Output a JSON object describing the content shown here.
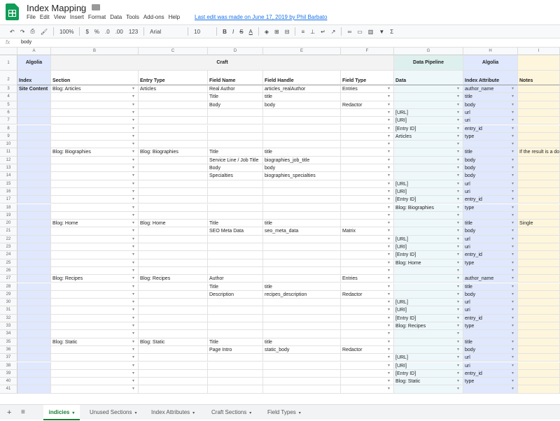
{
  "app": {
    "title": "Index Mapping",
    "last_edit": "Last edit was made on June 17, 2019 by Phil Barbato"
  },
  "menu": [
    "File",
    "Edit",
    "View",
    "Insert",
    "Format",
    "Data",
    "Tools",
    "Add-ons",
    "Help"
  ],
  "toolbar": {
    "zoom": "100%",
    "currency": "$",
    "percent": "%",
    ".0": ".0",
    ".00": ".00",
    "format_more": "123",
    "font": "Arial",
    "font_size": "10",
    "bold": "B",
    "italic": "I",
    "strike": "S",
    "text_color": "A"
  },
  "formula_bar": {
    "fx": "fx",
    "value": "body"
  },
  "columns": [
    "A",
    "B",
    "C",
    "D",
    "E",
    "F",
    "G",
    "H",
    "I"
  ],
  "header_rows": {
    "row1": {
      "index": "1",
      "algolia": "Algolia",
      "craft": "Craft",
      "pipeline": "Data Pipeline",
      "algolia2": "Algolia"
    },
    "row2": {
      "index": "2",
      "cols": [
        "Index",
        "Section",
        "Entry Type",
        "Field Name",
        "Field Handle",
        "Field Type",
        "Data",
        "Index Attribute",
        "Notes"
      ]
    }
  },
  "rows": [
    {
      "n": "3",
      "a": "Site Content",
      "b": "Blog: Articles",
      "c": "Articles",
      "d": "Real Author",
      "e": "articles_realAuthor",
      "f": "Entries",
      "g": "",
      "h": "author_name",
      "i": ""
    },
    {
      "n": "4",
      "a": "",
      "b": "",
      "c": "",
      "d": "Title",
      "e": "title",
      "f": "",
      "g": "",
      "h": "title",
      "i": ""
    },
    {
      "n": "5",
      "a": "",
      "b": "",
      "c": "",
      "d": "Body",
      "e": "body",
      "f": "Redactor",
      "g": "",
      "h": "body",
      "i": ""
    },
    {
      "n": "6",
      "a": "",
      "b": "",
      "c": "",
      "d": "",
      "e": "",
      "f": "",
      "g": "[URL]",
      "h": "url",
      "i": ""
    },
    {
      "n": "7",
      "a": "",
      "b": "",
      "c": "",
      "d": "",
      "e": "",
      "f": "",
      "g": "[URI]",
      "h": "uri",
      "i": ""
    },
    {
      "n": "8",
      "a": "",
      "b": "",
      "c": "",
      "d": "",
      "e": "",
      "f": "",
      "g": "[Entry ID]",
      "h": "entry_id",
      "i": ""
    },
    {
      "n": "9",
      "a": "",
      "b": "",
      "c": "",
      "d": "",
      "e": "",
      "f": "",
      "g": "Articles",
      "h": "type",
      "i": ""
    },
    {
      "n": "10",
      "a": "",
      "b": "",
      "c": "",
      "d": "",
      "e": "",
      "f": "",
      "g": "",
      "h": "",
      "i": ""
    },
    {
      "n": "11",
      "a": "",
      "b": "Blog: Biographies",
      "c": "Blog: Biographies",
      "d": "Title",
      "e": "title",
      "f": "",
      "g": "",
      "h": "title",
      "i": "If the result is a do"
    },
    {
      "n": "12",
      "a": "",
      "b": "",
      "c": "",
      "d": "Service Line / Job Title",
      "e": "biographies_job_title",
      "f": "",
      "g": "",
      "h": "body",
      "i": ""
    },
    {
      "n": "13",
      "a": "",
      "b": "",
      "c": "",
      "d": "Body",
      "e": "body",
      "f": "",
      "g": "",
      "h": "body",
      "i": ""
    },
    {
      "n": "14",
      "a": "",
      "b": "",
      "c": "",
      "d": "Specialties",
      "e": "biographies_specialties",
      "f": "",
      "g": "",
      "h": "body",
      "i": ""
    },
    {
      "n": "15",
      "a": "",
      "b": "",
      "c": "",
      "d": "",
      "e": "",
      "f": "",
      "g": "[URL]",
      "h": "url",
      "i": ""
    },
    {
      "n": "16",
      "a": "",
      "b": "",
      "c": "",
      "d": "",
      "e": "",
      "f": "",
      "g": "[URI]",
      "h": "uri",
      "i": ""
    },
    {
      "n": "17",
      "a": "",
      "b": "",
      "c": "",
      "d": "",
      "e": "",
      "f": "",
      "g": "[Entry ID]",
      "h": "entry_id",
      "i": ""
    },
    {
      "n": "18",
      "a": "",
      "b": "",
      "c": "",
      "d": "",
      "e": "",
      "f": "",
      "g": "Blog: Biographies",
      "h": "type",
      "i": ""
    },
    {
      "n": "19",
      "a": "",
      "b": "",
      "c": "",
      "d": "",
      "e": "",
      "f": "",
      "g": "",
      "h": "",
      "i": ""
    },
    {
      "n": "20",
      "a": "",
      "b": "Blog: Home",
      "c": "Blog: Home",
      "d": "Title",
      "e": "title",
      "f": "",
      "g": "",
      "h": "title",
      "i": "Single"
    },
    {
      "n": "21",
      "a": "",
      "b": "",
      "c": "",
      "d": "SEO Meta Data",
      "e": "seo_meta_data",
      "f": "Matrix",
      "g": "",
      "h": "body",
      "i": ""
    },
    {
      "n": "22",
      "a": "",
      "b": "",
      "c": "",
      "d": "",
      "e": "",
      "f": "",
      "g": "[URL]",
      "h": "url",
      "i": ""
    },
    {
      "n": "23",
      "a": "",
      "b": "",
      "c": "",
      "d": "",
      "e": "",
      "f": "",
      "g": "[URI]",
      "h": "uri",
      "i": ""
    },
    {
      "n": "24",
      "a": "",
      "b": "",
      "c": "",
      "d": "",
      "e": "",
      "f": "",
      "g": "[Entry ID]",
      "h": "entry_id",
      "i": ""
    },
    {
      "n": "25",
      "a": "",
      "b": "",
      "c": "",
      "d": "",
      "e": "",
      "f": "",
      "g": "Blog: Home",
      "h": "type",
      "i": ""
    },
    {
      "n": "26",
      "a": "",
      "b": "",
      "c": "",
      "d": "",
      "e": "",
      "f": "",
      "g": "",
      "h": "",
      "i": ""
    },
    {
      "n": "27",
      "a": "",
      "b": "Blog: Recipes",
      "c": "Blog: Recipes",
      "d": "Author",
      "e": "",
      "f": "Entries",
      "g": "",
      "h": "author_name",
      "i": ""
    },
    {
      "n": "28",
      "a": "",
      "b": "",
      "c": "",
      "d": "Title",
      "e": "title",
      "f": "",
      "g": "",
      "h": "title",
      "i": ""
    },
    {
      "n": "29",
      "a": "",
      "b": "",
      "c": "",
      "d": "Description",
      "e": "recipes_description",
      "f": "Redactor",
      "g": "",
      "h": "body",
      "i": ""
    },
    {
      "n": "30",
      "a": "",
      "b": "",
      "c": "",
      "d": "",
      "e": "",
      "f": "",
      "g": "[URL]",
      "h": "url",
      "i": ""
    },
    {
      "n": "31",
      "a": "",
      "b": "",
      "c": "",
      "d": "",
      "e": "",
      "f": "",
      "g": "[URI]",
      "h": "uri",
      "i": ""
    },
    {
      "n": "32",
      "a": "",
      "b": "",
      "c": "",
      "d": "",
      "e": "",
      "f": "",
      "g": "[Entry ID]",
      "h": "entry_id",
      "i": ""
    },
    {
      "n": "33",
      "a": "",
      "b": "",
      "c": "",
      "d": "",
      "e": "",
      "f": "",
      "g": "Blog: Recipes",
      "h": "type",
      "i": ""
    },
    {
      "n": "34",
      "a": "",
      "b": "",
      "c": "",
      "d": "",
      "e": "",
      "f": "",
      "g": "",
      "h": "",
      "i": ""
    },
    {
      "n": "35",
      "a": "",
      "b": "Blog: Static",
      "c": "Blog: Static",
      "d": "Title",
      "e": "title",
      "f": "",
      "g": "",
      "h": "title",
      "i": ""
    },
    {
      "n": "36",
      "a": "",
      "b": "",
      "c": "",
      "d": "Page Intro",
      "e": "static_body",
      "f": "Redactor",
      "g": "",
      "h": "body",
      "i": ""
    },
    {
      "n": "37",
      "a": "",
      "b": "",
      "c": "",
      "d": "",
      "e": "",
      "f": "",
      "g": "[URL]",
      "h": "url",
      "i": ""
    },
    {
      "n": "38",
      "a": "",
      "b": "",
      "c": "",
      "d": "",
      "e": "",
      "f": "",
      "g": "[URI]",
      "h": "uri",
      "i": ""
    },
    {
      "n": "39",
      "a": "",
      "b": "",
      "c": "",
      "d": "",
      "e": "",
      "f": "",
      "g": "[Entry ID]",
      "h": "entry_id",
      "i": ""
    },
    {
      "n": "40",
      "a": "",
      "b": "",
      "c": "",
      "d": "",
      "e": "",
      "f": "",
      "g": "Blog: Static",
      "h": "type",
      "i": ""
    },
    {
      "n": "41",
      "a": "",
      "b": "",
      "c": "",
      "d": "",
      "e": "",
      "f": "",
      "g": "",
      "h": "",
      "i": ""
    }
  ],
  "sheets": [
    {
      "label": "indicies",
      "active": true
    },
    {
      "label": "Unused Sections",
      "active": false
    },
    {
      "label": "Index Attributes",
      "active": false
    },
    {
      "label": "Craft Sections",
      "active": false
    },
    {
      "label": "Field Types",
      "active": false
    }
  ],
  "colors": {
    "algolia_bg": "#dfe8fd",
    "pipeline_bg": "#ddf0ee",
    "notes_bg": "#fef6dc",
    "craft_bg": "#f3f3f3",
    "data_col_bg": "#eef8fb",
    "accent": "#188038"
  }
}
